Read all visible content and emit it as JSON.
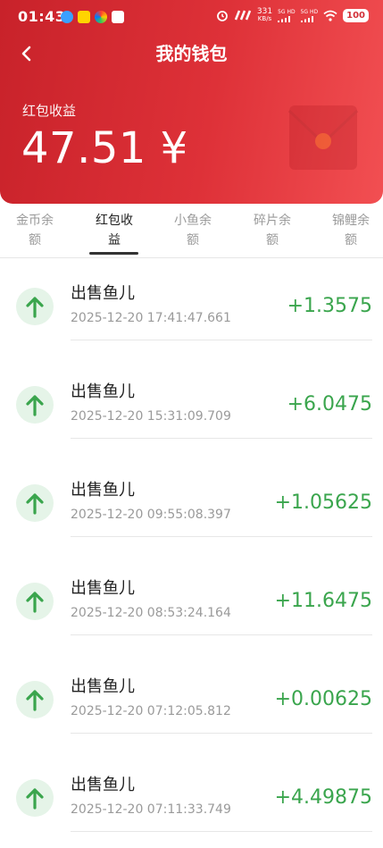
{
  "status_bar": {
    "time": "01:43",
    "net_speed": "331",
    "net_unit": "KB/s",
    "sim1": "5G HD",
    "sim2": "5G HD",
    "battery": "100"
  },
  "header": {
    "title": "我的钱包",
    "balance_label": "红包收益",
    "balance_value": "47.51 ¥"
  },
  "tabs": [
    {
      "line1": "金币余",
      "line2": "额"
    },
    {
      "line1": "红包收",
      "line2": "益"
    },
    {
      "line1": "小鱼余",
      "line2": "额"
    },
    {
      "line1": "碎片余",
      "line2": "额"
    },
    {
      "line1": "锦鲤余",
      "line2": "额"
    }
  ],
  "active_tab": 1,
  "transactions": [
    {
      "name": "出售鱼儿",
      "date": "2025-12-20 17:41:47.661",
      "amount": "+1.3575"
    },
    {
      "name": "出售鱼儿",
      "date": "2025-12-20 15:31:09.709",
      "amount": "+6.0475"
    },
    {
      "name": "出售鱼儿",
      "date": "2025-12-20 09:55:08.397",
      "amount": "+1.05625"
    },
    {
      "name": "出售鱼儿",
      "date": "2025-12-20 08:53:24.164",
      "amount": "+11.6475"
    },
    {
      "name": "出售鱼儿",
      "date": "2025-12-20 07:12:05.812",
      "amount": "+0.00625"
    },
    {
      "name": "出售鱼儿",
      "date": "2025-12-20 07:11:33.749",
      "amount": "+4.49875"
    }
  ],
  "colors": {
    "header_red": "#d5272f",
    "positive_green": "#3aa54d",
    "icon_bg": "#e5f4e8"
  }
}
